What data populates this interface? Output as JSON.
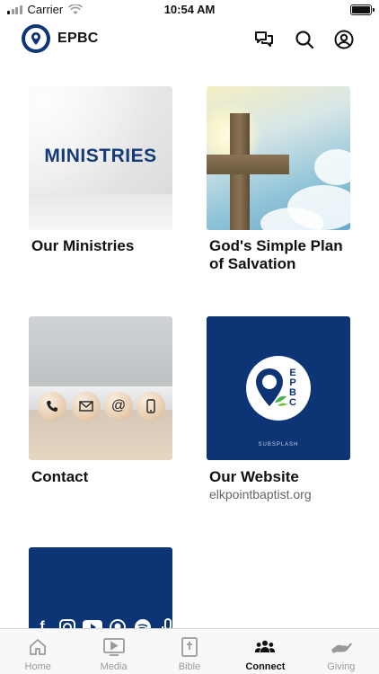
{
  "status_bar": {
    "carrier": "Carrier",
    "time": "10:54 AM"
  },
  "header": {
    "title": "EPBC"
  },
  "cards": [
    {
      "title": "Our Ministries",
      "image_text": "MINISTRIES"
    },
    {
      "title": "God's Simple Plan of Salvation"
    },
    {
      "title": "Contact"
    },
    {
      "title": "Our Website",
      "subtitle": "elkpointbaptist.org",
      "image_text": "EPBC",
      "image_brand": "SUBSPLASH"
    }
  ],
  "tabs": [
    {
      "label": "Home",
      "icon": "home-icon"
    },
    {
      "label": "Media",
      "icon": "media-icon"
    },
    {
      "label": "Bible",
      "icon": "bible-icon"
    },
    {
      "label": "Connect",
      "icon": "people-icon",
      "active": true
    },
    {
      "label": "Giving",
      "icon": "giving-icon"
    }
  ],
  "colors": {
    "brand": "#0d3474",
    "active_tab": "#111111",
    "inactive_tab": "#9a9a9a"
  }
}
